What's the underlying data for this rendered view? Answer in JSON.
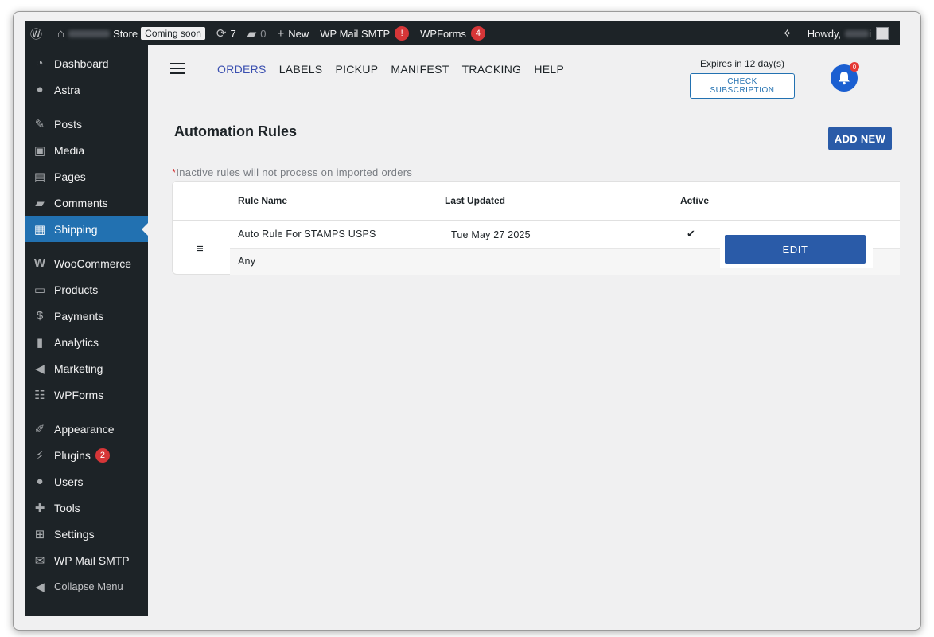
{
  "adminbar": {
    "wp_logo_icon": "wordpress-icon",
    "site_name_suffix": "Store",
    "coming_soon": "Coming soon",
    "updates_count": "7",
    "comments_count": "0",
    "new_label": "New",
    "wp_mail_smtp": "WP Mail SMTP",
    "wp_mail_smtp_badge": "!",
    "wpforms": "WPForms",
    "wpforms_badge": "4",
    "howdy": "Howdy,",
    "howdy_suffix": "i"
  },
  "sidebar": {
    "items": [
      {
        "label": "Dashboard",
        "icon": "dashboard-icon"
      },
      {
        "label": "Astra",
        "icon": "astra-icon"
      },
      {
        "label": "Posts",
        "icon": "pin-icon"
      },
      {
        "label": "Media",
        "icon": "media-icon"
      },
      {
        "label": "Pages",
        "icon": "pages-icon"
      },
      {
        "label": "Comments",
        "icon": "comment-icon"
      },
      {
        "label": "Shipping",
        "icon": "grid-icon"
      },
      {
        "label": "WooCommerce",
        "icon": "woocommerce-icon"
      },
      {
        "label": "Products",
        "icon": "archive-icon"
      },
      {
        "label": "Payments",
        "icon": "payments-icon"
      },
      {
        "label": "Analytics",
        "icon": "analytics-icon"
      },
      {
        "label": "Marketing",
        "icon": "megaphone-icon"
      },
      {
        "label": "WPForms",
        "icon": "forms-icon"
      },
      {
        "label": "Appearance",
        "icon": "brush-icon"
      },
      {
        "label": "Plugins",
        "icon": "plugin-icon",
        "badge": "2"
      },
      {
        "label": "Users",
        "icon": "user-icon"
      },
      {
        "label": "Tools",
        "icon": "wrench-icon"
      },
      {
        "label": "Settings",
        "icon": "settings-icon"
      },
      {
        "label": "WP Mail SMTP",
        "icon": "mail-icon"
      },
      {
        "label": "Collapse Menu",
        "icon": "collapse-icon"
      }
    ],
    "active": "Shipping"
  },
  "nav": {
    "tabs": [
      "ORDERS",
      "LABELS",
      "PICKUP",
      "MANIFEST",
      "TRACKING",
      "HELP"
    ],
    "active_tab": "ORDERS",
    "expires": "Expires in 12 day(s)",
    "check_subscription": "CHECK SUBSCRIPTION",
    "bell_badge": "0"
  },
  "page": {
    "title": "Automation Rules",
    "add_new": "ADD NEW",
    "note_asterisk": "*",
    "note": "Inactive rules will not process on imported orders"
  },
  "table": {
    "headers": {
      "rule_name": "Rule Name",
      "last_updated": "Last Updated",
      "active": "Active"
    },
    "rows": [
      {
        "rule_name": "Auto Rule For STAMPS USPS",
        "last_updated": "Tue May 27 2025",
        "active": "✔",
        "sub": "Any",
        "edit": "EDIT"
      }
    ]
  },
  "colors": {
    "sidebar_bg": "#1d2327",
    "active_blue": "#2271b1",
    "button_blue": "#2a5ba8",
    "tab_active": "#3a4fb0",
    "badge_red": "#d63638"
  }
}
